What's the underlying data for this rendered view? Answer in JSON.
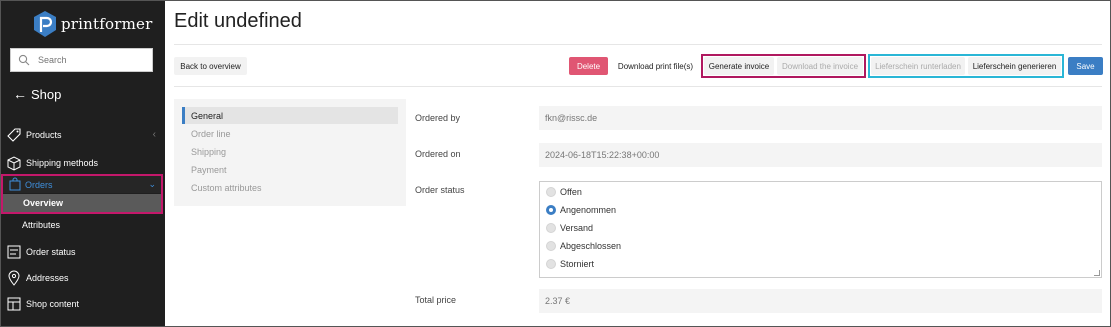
{
  "app": {
    "name": "printformer"
  },
  "search": {
    "placeholder": "Search"
  },
  "sidebar": {
    "back_label": "Shop",
    "items": [
      {
        "label": "Products"
      },
      {
        "label": "Shipping methods"
      },
      {
        "label": "Orders"
      },
      {
        "label": "Overview"
      },
      {
        "label": "Attributes"
      },
      {
        "label": "Order status"
      },
      {
        "label": "Addresses"
      },
      {
        "label": "Shop content"
      }
    ]
  },
  "page": {
    "title": "Edit undefined"
  },
  "toolbar": {
    "back": "Back to overview",
    "delete": "Delete",
    "download_print": "Download print file(s)",
    "generate_invoice": "Generate invoice",
    "download_invoice": "Download the invoice",
    "lieferschein_download": "Lieferschein runterladen",
    "lieferschein_generate": "Lieferschein generieren",
    "save": "Save"
  },
  "tabs": [
    {
      "label": "General",
      "active": true
    },
    {
      "label": "Order line"
    },
    {
      "label": "Shipping"
    },
    {
      "label": "Payment"
    },
    {
      "label": "Custom attributes"
    }
  ],
  "form": {
    "ordered_by": {
      "label": "Ordered by",
      "value": "fkn@rissc.de"
    },
    "ordered_on": {
      "label": "Ordered on",
      "value": "2024-06-18T15:22:38+00:00"
    },
    "order_status": {
      "label": "Order status",
      "options": [
        "Offen",
        "Angenommen",
        "Versand",
        "Abgeschlossen",
        "Storniert"
      ],
      "selected": "Angenommen"
    },
    "total_price": {
      "label": "Total price",
      "value": "2.37 €"
    }
  },
  "colors": {
    "accent": "#3b7ec4",
    "delete": "#e05673",
    "highlight_magenta": "#c4186b",
    "highlight_cyan": "#2ab6d6",
    "sidebar_bg": "#1f1f1f"
  }
}
